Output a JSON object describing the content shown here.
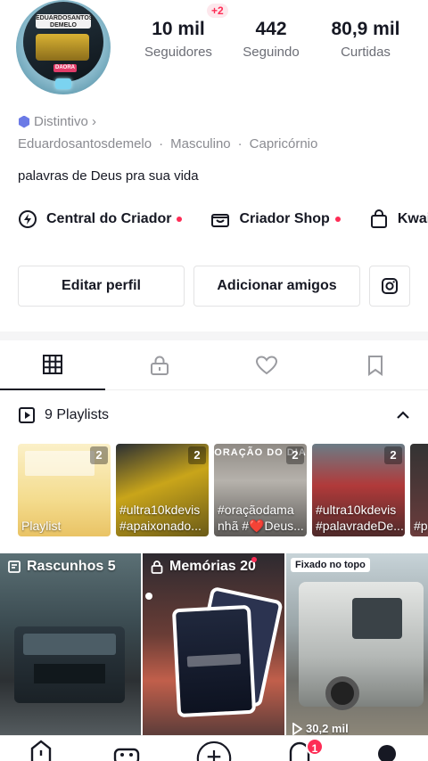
{
  "profile": {
    "avatar_logo_text": "EDUARDOSANTOS DEMELO",
    "avatar_plate_text": "DAORA"
  },
  "stats": {
    "followers_value": "10 mil",
    "followers_label": "Seguidores",
    "followers_new_badge": "+2",
    "following_value": "442",
    "following_label": "Seguindo",
    "likes_value": "80,9 mil",
    "likes_label": "Curtidas"
  },
  "bio": {
    "badge_label": "Distintivo ›",
    "info": [
      "Eduardosantosdemelo",
      "·",
      "Masculino",
      "·",
      "Capricórnio"
    ],
    "text": "palavras de Deus pra sua vida"
  },
  "tools": [
    {
      "label": "Central do Criador",
      "icon": "bolt-icon",
      "dot": true
    },
    {
      "label": "Criador Shop",
      "icon": "shop-icon",
      "dot": true
    },
    {
      "label": "Kwai",
      "icon": "bag-icon",
      "dot": false
    }
  ],
  "buttons": {
    "edit_profile": "Editar perfil",
    "add_friends": "Adicionar amigos",
    "instagram_icon": "instagram-icon"
  },
  "tabs": [
    "grid-icon",
    "lock-icon",
    "heart-icon",
    "bookmark-icon"
  ],
  "playlists": {
    "header": "9 Playlists",
    "items": [
      {
        "count": "2",
        "caption": "Playlist"
      },
      {
        "count": "2",
        "caption": "#ultra10kdevis #apaixonado..."
      },
      {
        "count": "2",
        "caption": "#oraçãodama nhã #❤️Deus...",
        "header_text": "ORAÇÃO DO DIA"
      },
      {
        "count": "2",
        "caption": "#ultra10kdevis #palavradeDe..."
      },
      {
        "count": "",
        "caption": "#p s"
      }
    ]
  },
  "videos": {
    "drafts_label": "Rascunhos 5",
    "memories_label": "Memórias 20",
    "pinned_label": "Fixado no topo",
    "pinned_views": "30,2 mil"
  },
  "nav": {
    "inbox_badge": "1"
  },
  "colors": {
    "accent": "#fe2c55",
    "text": "#161823",
    "muted": "#8a8b91",
    "badge_icon": "#6b7ae6"
  }
}
